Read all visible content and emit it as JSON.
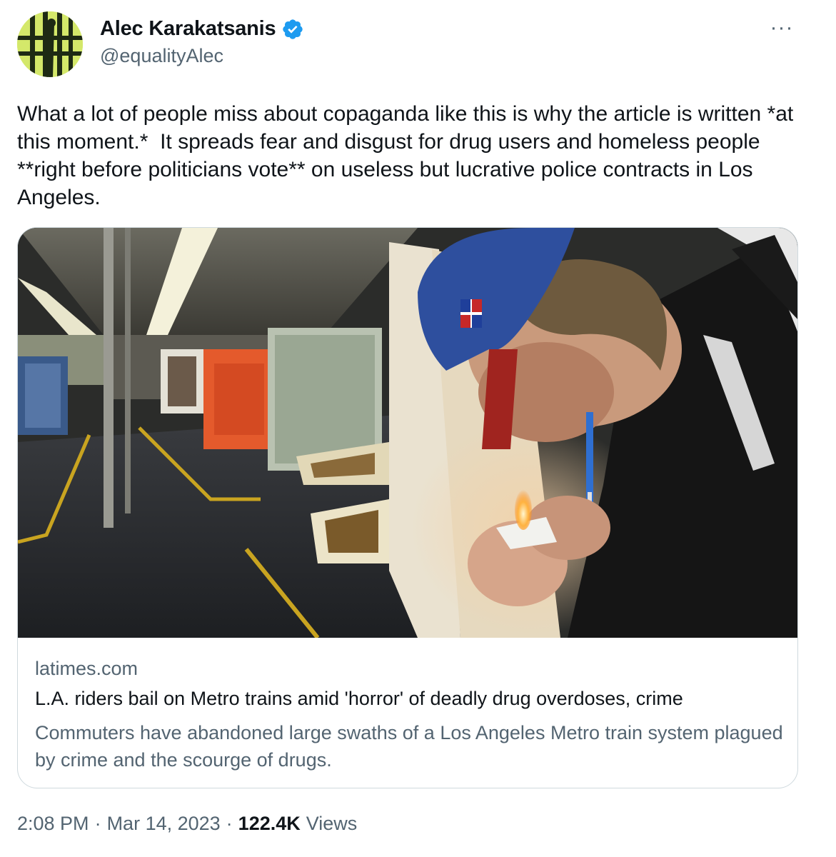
{
  "author": {
    "display_name": "Alec Karakatsanis",
    "handle": "@equalityAlec",
    "verified": true,
    "avatar_icon": "avatar-jail-bars-icon",
    "avatar_color": "#d4e86a"
  },
  "more_icon": "more-horizontal-icon",
  "more_label": "···",
  "tweet": {
    "text": "What a lot of people miss about copaganda like this is why the article is written *at this moment.*  It spreads fear and disgust for drug users and homeless people **right before politicians vote** on useless but lucrative police contracts in Los Angeles."
  },
  "link_card": {
    "domain": "latimes.com",
    "title": "L.A. riders bail on Metro trains amid 'horror' of deadly drug overdoses, crime",
    "description": "Commuters have abandoned large swaths of a Los Angeles Metro train system plagued by crime and the scourge of drugs.",
    "image_icon": "article-photo-metro-train-icon"
  },
  "meta": {
    "time": "2:08 PM",
    "separator": "·",
    "date": "Mar 14, 2023",
    "views_count": "122.4K",
    "views_label": "Views"
  },
  "colors": {
    "text_primary": "#0f1419",
    "text_secondary": "#536471",
    "border": "#cfd9de",
    "verified_blue": "#1d9bf0"
  }
}
